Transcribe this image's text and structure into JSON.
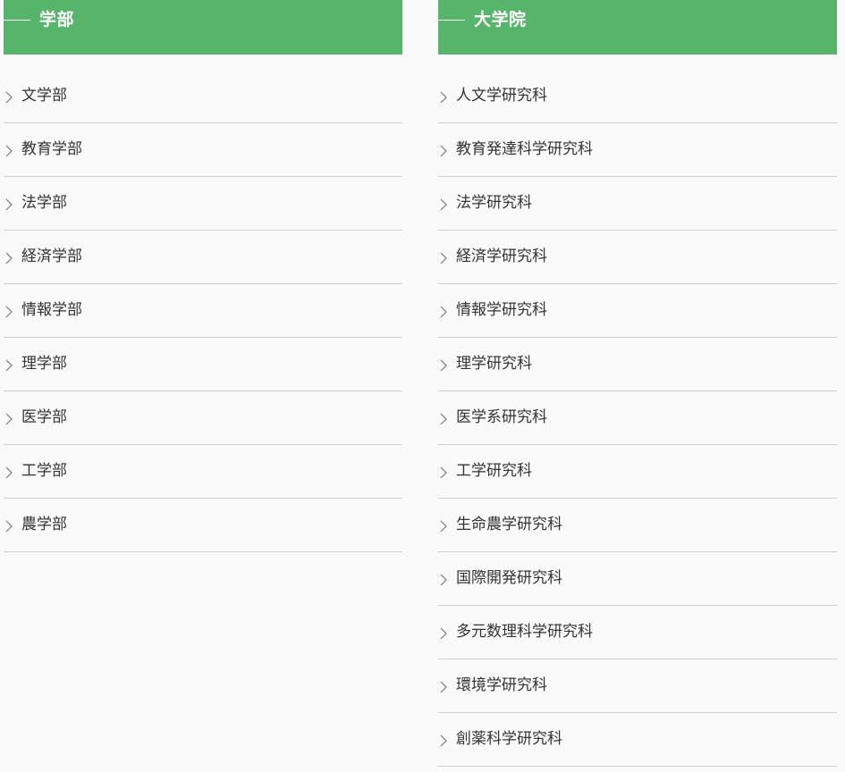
{
  "faculties": {
    "title": "学部",
    "items": [
      {
        "label": "文学部"
      },
      {
        "label": "教育学部"
      },
      {
        "label": "法学部"
      },
      {
        "label": "経済学部"
      },
      {
        "label": "情報学部"
      },
      {
        "label": "理学部"
      },
      {
        "label": "医学部"
      },
      {
        "label": "工学部"
      },
      {
        "label": "農学部"
      }
    ]
  },
  "graduate_schools": {
    "title": "大学院",
    "items": [
      {
        "label": "人文学研究科"
      },
      {
        "label": "教育発達科学研究科"
      },
      {
        "label": "法学研究科"
      },
      {
        "label": "経済学研究科"
      },
      {
        "label": "情報学研究科"
      },
      {
        "label": "理学研究科"
      },
      {
        "label": "医学系研究科"
      },
      {
        "label": "工学研究科"
      },
      {
        "label": "生命農学研究科"
      },
      {
        "label": "国際開発研究科"
      },
      {
        "label": "多元数理科学研究科"
      },
      {
        "label": "環境学研究科"
      },
      {
        "label": "創薬科学研究科"
      }
    ]
  },
  "icons": {
    "item_icon": "chevron-right-icon"
  },
  "colors": {
    "header_bg": "#57b56b",
    "header_text": "#ffffff",
    "item_text": "#333333",
    "divider": "#cfcfcf"
  }
}
